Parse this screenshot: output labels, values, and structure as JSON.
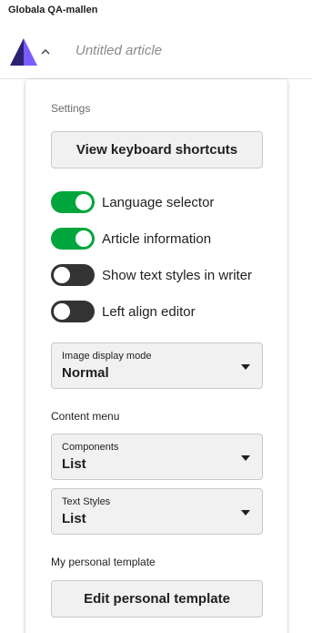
{
  "header": {
    "org_name": "Globala QA-mallen",
    "doc_title": "Untitled article",
    "logo_icon": "triangle-logo-icon",
    "chevron_icon": "chevron-up-icon"
  },
  "settings": {
    "heading": "Settings",
    "keyboard_button": "View keyboard shortcuts",
    "toggles": [
      {
        "label": "Language selector",
        "on": true
      },
      {
        "label": "Article information",
        "on": true
      },
      {
        "label": "Show text styles in writer",
        "on": false
      },
      {
        "label": "Left align editor",
        "on": false
      }
    ],
    "image_display": {
      "label": "Image display mode",
      "value": "Normal"
    }
  },
  "content_menu": {
    "heading": "Content menu",
    "components": {
      "label": "Components",
      "value": "List"
    },
    "text_styles": {
      "label": "Text Styles",
      "value": "List"
    }
  },
  "personal_template": {
    "heading": "My personal template",
    "edit_button": "Edit personal template"
  },
  "colors": {
    "toggle_on": "#00a63c",
    "toggle_off": "#333333",
    "logo_dark": "#2b2170",
    "logo_light": "#7a5cff"
  }
}
